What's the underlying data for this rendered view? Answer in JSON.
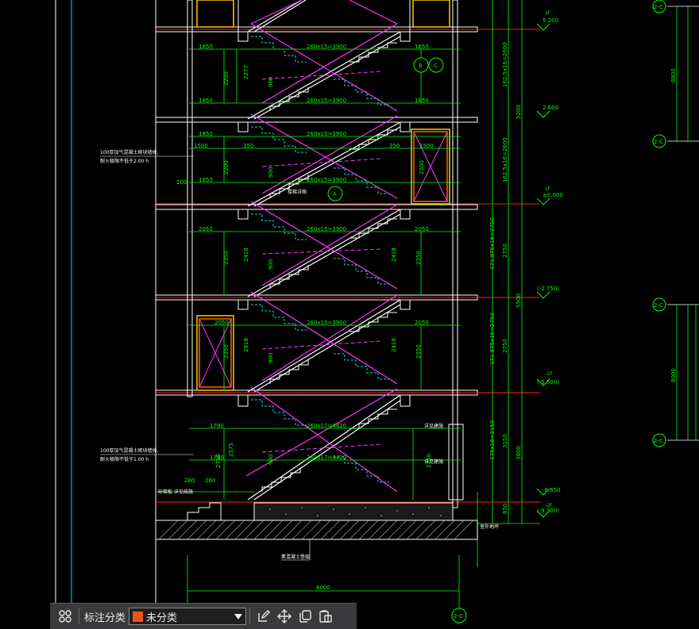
{
  "drawing": {
    "colors": {
      "wall": "#ffffff",
      "dimension": "#00ff00",
      "stair": "#ff33ff",
      "hatch": "#00e0e0",
      "axis": "#ff2020",
      "window": "#ffcc00",
      "note": "#ffffff"
    },
    "axis_tags": {
      "top_right": "2-C",
      "mid_right": "2-C",
      "mid_right_b": "2-C",
      "mid_right_c": "2-C",
      "mid_right_d": "2-C",
      "bottom": "2-C"
    },
    "circle_tags": {
      "b": "B",
      "c": "C",
      "a": "A"
    },
    "elevations": {
      "e1": "5.200",
      "e2": "2.600",
      "e3": "±0.000",
      "e4": "(-2.750)",
      "e5": "(-5.500)",
      "e6": "-8.650",
      "e7": "(-9.300)"
    },
    "floor_tags": {
      "f1": "2F",
      "f2": "1F",
      "f3": "-1F",
      "f4": "-2F"
    },
    "right_dims": {
      "d1": "162.5x16=2600",
      "d2": "162.5x16=2600",
      "d3": "5200",
      "d4": "171.875x16=2750",
      "d5": "171.875x16=2750",
      "d6": "2750",
      "d7": "2750",
      "d8": "5500",
      "d9": "175x18=3150",
      "d10": "3150",
      "d11": "3800",
      "d12": "650"
    },
    "stair_labels": {
      "s1": "260x15=3900",
      "s2": "260x15=3900",
      "s3": "260x15=3900",
      "s4": "260x15=3900",
      "s5": "260x15=3900",
      "s6": "260x15=3900",
      "s7": "260x17=4420",
      "s8": "260x17=4420"
    },
    "landing_dims": {
      "l1850": "1850",
      "l2200": "2200",
      "l2050": "2050",
      "l2350": "2350",
      "l1790": "1790",
      "l1500": "1500",
      "l2750": "2750",
      "l350": "350",
      "l900": "900",
      "l2277": "2277",
      "l2418": "2418",
      "l2575": "2575",
      "l200": "200",
      "l260": "260"
    },
    "bottom_dim": "8000",
    "right_partial_dims": {
      "p1": "8800",
      "p2": "8000"
    },
    "notes": {
      "n1a": "100厚加气混凝土砌块墙体,",
      "n1b": "耐火极限不低于2.00 h",
      "n2a": "100厚加气混凝土砌块墙体,",
      "n2b": "耐火极限不低于1.00 h",
      "n3": "楼梯详图",
      "n4": "详见建施",
      "n5": "砼梯板 详见结施",
      "n6": "室外地坪",
      "n7": "素混凝土垫层"
    }
  },
  "toolbar": {
    "grid_icon": "grid-icon",
    "label": "标注分类",
    "select_value": "未分类",
    "select_color": "#e8541e",
    "tools": [
      "edit-icon",
      "move-icon",
      "copy-icon",
      "paste-icon"
    ]
  }
}
